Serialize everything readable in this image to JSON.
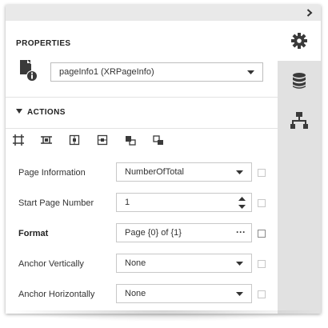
{
  "panel": {
    "title": "PROPERTIES",
    "component": {
      "icon": "page-info-component-icon",
      "selected": "pageInfo1 (XRPageInfo)"
    }
  },
  "side_tabs": [
    {
      "name": "properties",
      "icon": "gear-icon",
      "active": true
    },
    {
      "name": "field-list",
      "icon": "database-icon",
      "active": false
    },
    {
      "name": "report-explorer",
      "icon": "hierarchy-icon",
      "active": false
    }
  ],
  "actions": {
    "label": "ACTIONS",
    "tools": [
      {
        "icon": "fit-bounds-to-text-icon"
      },
      {
        "icon": "fit-text-to-bounds-icon"
      },
      {
        "icon": "center-horizontally-icon"
      },
      {
        "icon": "center-vertically-icon"
      },
      {
        "icon": "bring-to-front-icon"
      },
      {
        "icon": "send-to-back-icon"
      }
    ]
  },
  "properties": [
    {
      "label": "Page Information",
      "value": "NumberOfTotal",
      "editor": "dropdown",
      "bold": false
    },
    {
      "label": "Start Page Number",
      "value": "1",
      "editor": "spinner",
      "bold": false
    },
    {
      "label": "Format",
      "value": "Page {0} of {1}",
      "editor": "ellipsis",
      "bold": true
    },
    {
      "label": "Anchor Vertically",
      "value": "None",
      "editor": "dropdown",
      "bold": false
    },
    {
      "label": "Anchor Horizontally",
      "value": "None",
      "editor": "dropdown",
      "bold": false
    }
  ],
  "format_button": "···",
  "colors": {
    "side_background": "#e1e1e1",
    "top_bar": "#e9e9e9",
    "icon_dark": "#3a3a3a"
  }
}
